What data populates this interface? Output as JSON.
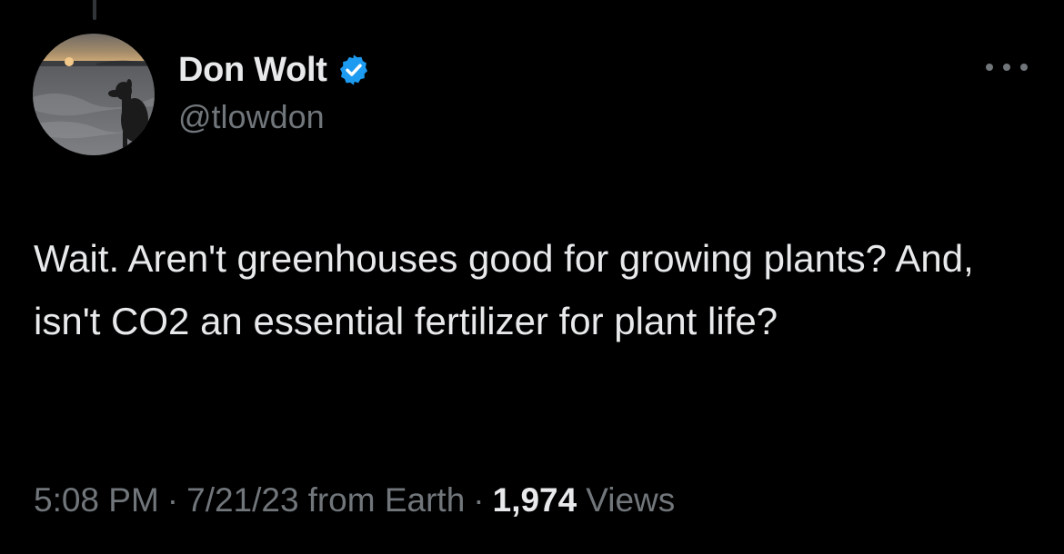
{
  "tweet": {
    "author": {
      "display_name": "Don Wolt",
      "handle": "@tlowdon",
      "verified": true,
      "avatar_icon": "avatar-photo-dog-on-beach-at-sunset"
    },
    "text": "Wait. Aren't greenhouses good for growing plants? And, isn't CO2 an essential fertilizer for plant life?",
    "time": "5:08 PM",
    "separator": "·",
    "date": "7/21/23",
    "source": "from Earth",
    "views_count": "1,974",
    "views_label": "Views",
    "more_icon": "more-horizontal-icon",
    "verified_icon": "verified-badge-icon"
  },
  "theme": {
    "background": "#000000",
    "primary_text": "#e7e9ea",
    "secondary_text": "#71767b",
    "verified_blue": "#1d9bf0"
  }
}
